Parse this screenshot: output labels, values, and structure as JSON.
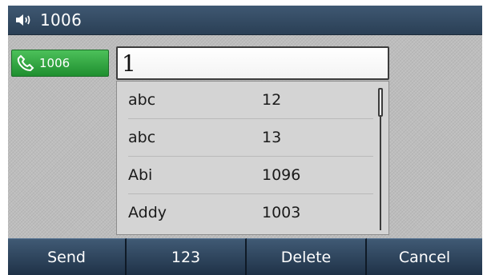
{
  "title_bar": {
    "icon": "speaker-volume-icon",
    "text": "1006"
  },
  "line_key": {
    "icon": "phone-icon",
    "label": "1006",
    "color": "#2ea23d"
  },
  "dial_input": {
    "value": "1"
  },
  "suggestions": [
    {
      "name": "abc",
      "number": "12"
    },
    {
      "name": "abc",
      "number": "13"
    },
    {
      "name": "Abi",
      "number": "1096"
    },
    {
      "name": "Addy",
      "number": "1003"
    }
  ],
  "softkeys": [
    {
      "label": "Send"
    },
    {
      "label": "123"
    },
    {
      "label": "Delete"
    },
    {
      "label": "Cancel"
    }
  ]
}
